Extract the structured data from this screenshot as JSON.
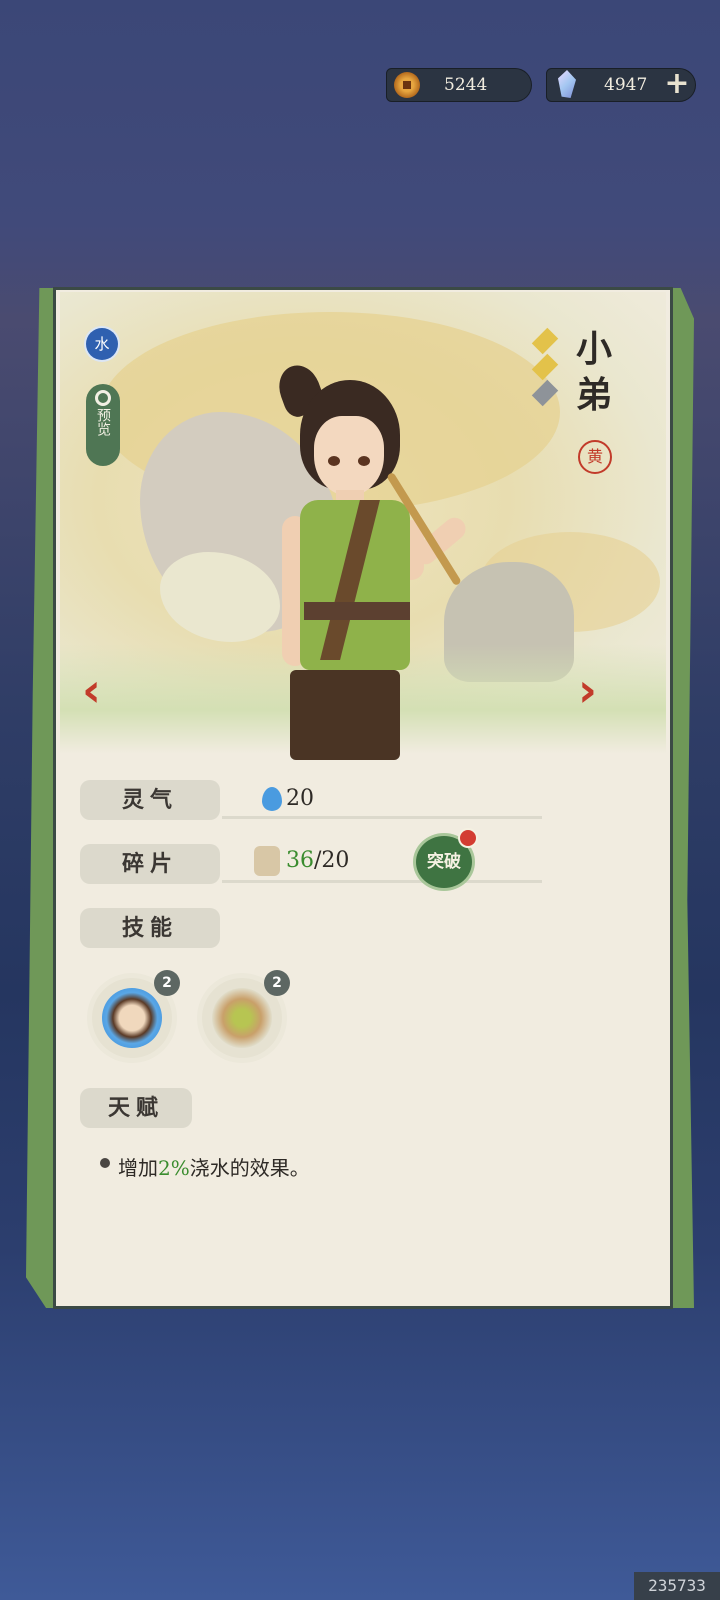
{
  "currency": {
    "coins": "5244",
    "gems": "4947",
    "coin_icon": "copper-coin-icon",
    "gem_icon": "spirit-crystal-icon",
    "plus_icon": "plus-icon"
  },
  "character": {
    "element_badge": "水",
    "preview_label": "预览",
    "name": "小弟",
    "rarity_seal": "黄",
    "stars_filled": 2,
    "stars_total": 3
  },
  "stats": {
    "spirit_label": "灵气",
    "spirit_value": "20",
    "fragments_label": "碎片",
    "fragments_current": "36",
    "fragments_required": "/20",
    "breakthrough_button": "突破",
    "skills_label": "技能",
    "talent_label": "天赋"
  },
  "skills": [
    {
      "level": "2",
      "icon": "boy-portrait-icon"
    },
    {
      "level": "2",
      "icon": "seedling-plot-icon"
    }
  ],
  "talent": {
    "prefix": "增加",
    "highlight": "2%",
    "suffix": "浇水的效果。"
  },
  "watermark": "235733",
  "colors": {
    "accent_green": "#3a8c2e",
    "arrow_red": "#c23b2a",
    "element_blue": "#2f60b0"
  }
}
